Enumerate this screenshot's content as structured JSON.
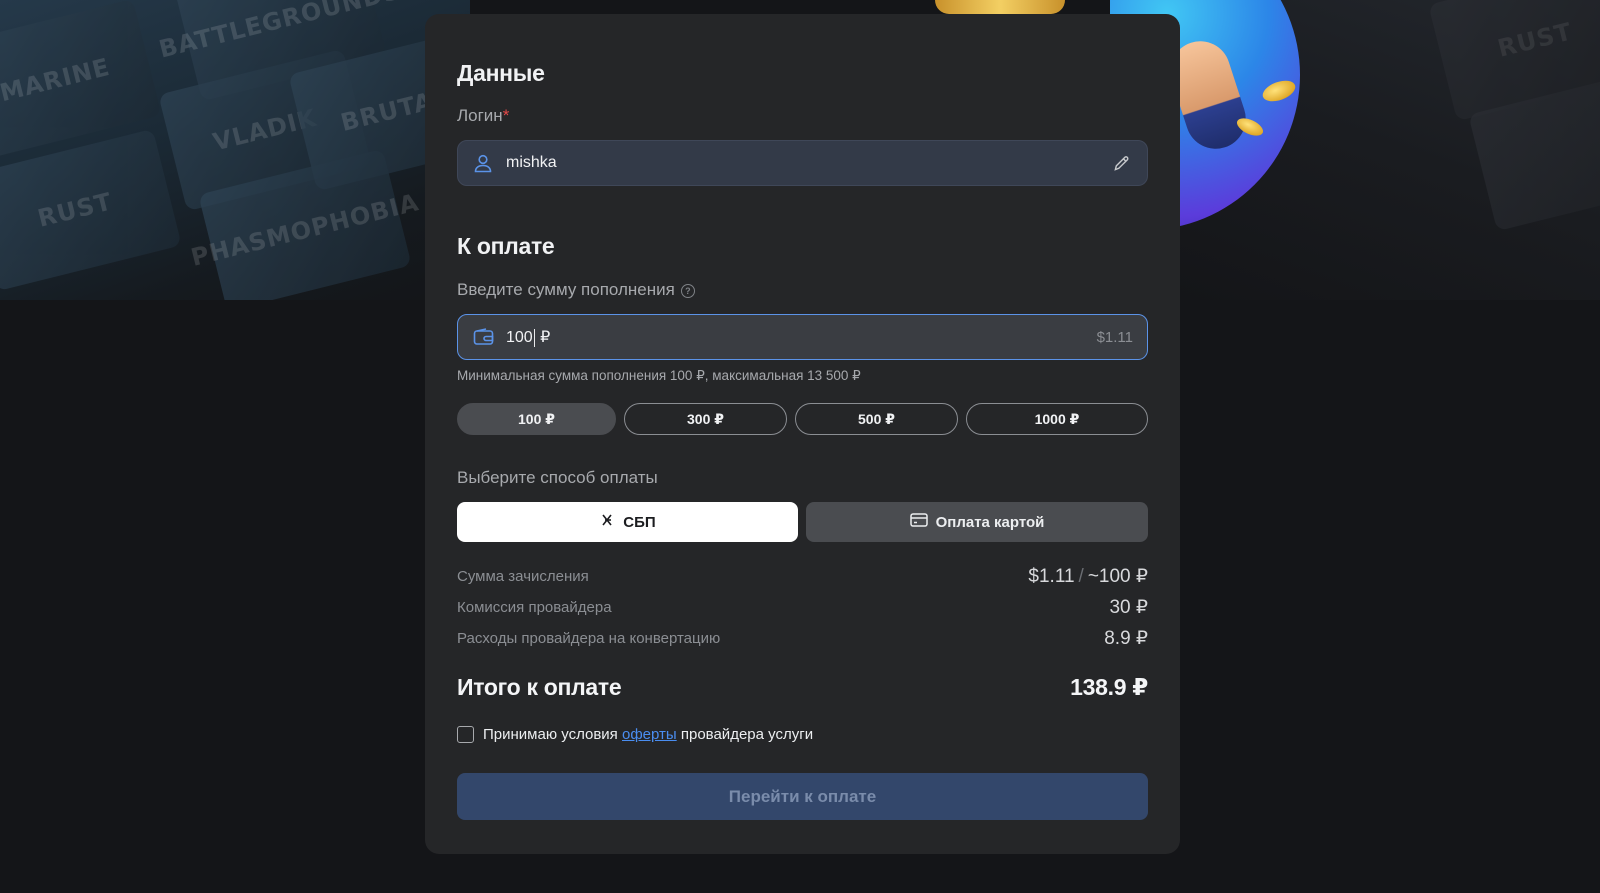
{
  "data_section": {
    "title": "Данные",
    "login_label": "Логин",
    "required_mark": "*",
    "login_value": "mishka"
  },
  "payment_section": {
    "title": "К оплате",
    "amount_label": "Введите сумму пополнения",
    "amount_value": "100",
    "currency": "₽",
    "amount_usd": "$1.11",
    "hint": "Минимальная сумма пополнения 100 ₽, максимальная 13 500 ₽",
    "presets": [
      {
        "label": "100 ₽",
        "active": true
      },
      {
        "label": "300 ₽",
        "active": false
      },
      {
        "label": "500 ₽",
        "active": false
      },
      {
        "label": "1000 ₽",
        "active": false
      }
    ],
    "method_label": "Выберите способ оплаты",
    "methods": {
      "sbp": "СБП",
      "card": "Оплата картой"
    }
  },
  "summary": {
    "credit_label": "Сумма зачисления",
    "credit_usd": "$1.11",
    "credit_sep": "/",
    "credit_rub": "~100 ₽",
    "fee_label": "Комиссия провайдера",
    "fee_value": "30 ₽",
    "conversion_label": "Расходы провайдера на конвертацию",
    "conversion_value": "8.9 ₽",
    "total_label": "Итого к оплате",
    "total_value": "138.9 ₽"
  },
  "terms": {
    "prefix": "Принимаю условия",
    "link": "оферты",
    "suffix": "провайдера услуги",
    "checked": false
  },
  "submit_label": "Перейти к оплате",
  "background_tiles": [
    "BATTLEGROUNDS",
    "MARINE",
    "VLADIK",
    "BRUTAL",
    "RUST",
    "PHASMOPHOBIA",
    "RUST"
  ],
  "colors": {
    "accent_blue": "#5b93e8",
    "link_blue": "#4a8df0",
    "required_red": "#e54a4a",
    "card_bg": "#252628",
    "submit_disabled": "#33476b"
  }
}
